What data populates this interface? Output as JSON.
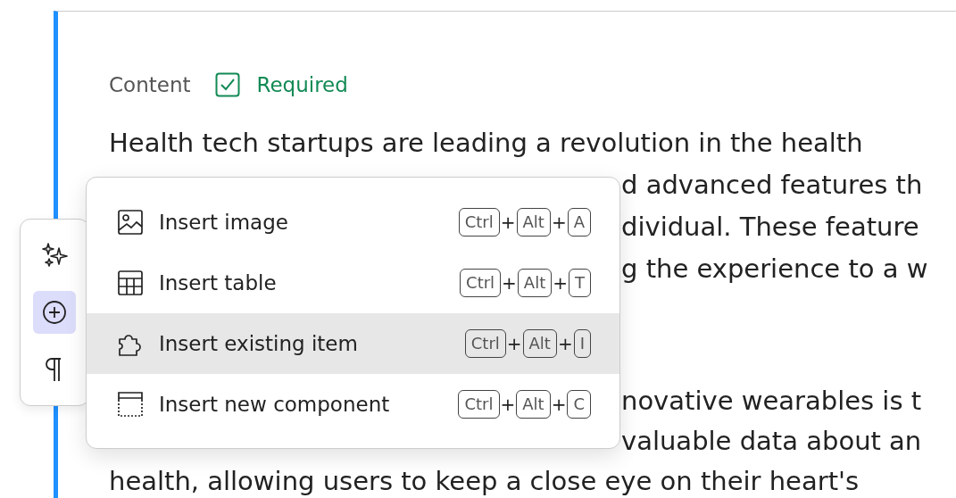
{
  "field": {
    "label": "Content",
    "required": {
      "checked": true,
      "label": "Required"
    }
  },
  "paragraphs": [
    {
      "lines": [
        {
          "kind": "full",
          "text": "Health tech startups are leading a revolution in the health"
        },
        {
          "kind": "fragment",
          "text": "d advanced features th"
        },
        {
          "kind": "fragment",
          "text": "dividual. These feature"
        },
        {
          "kind": "fragment",
          "text": "g the experience to a w"
        }
      ]
    },
    {
      "lines": [
        {
          "kind": "fragment",
          "text": "novative wearables is t"
        },
        {
          "kind": "fragment",
          "text": "valuable data about an"
        },
        {
          "kind": "full",
          "text": "health, allowing users to keep a close eye on their heart's"
        }
      ]
    }
  ],
  "toolbar": [
    {
      "kind": "sparkles",
      "selected": false
    },
    {
      "kind": "insert",
      "selected": true
    },
    {
      "kind": "paragraph",
      "selected": false
    }
  ],
  "menu": [
    {
      "kind": "image",
      "label": "Insert image",
      "selected": false,
      "shortcut": [
        {
          "kind": "key",
          "text": "Ctrl"
        },
        {
          "kind": "plus",
          "text": "+"
        },
        {
          "kind": "key",
          "text": "Alt"
        },
        {
          "kind": "plus",
          "text": "+"
        },
        {
          "kind": "key",
          "text": "A"
        }
      ]
    },
    {
      "kind": "table",
      "label": "Insert table",
      "selected": false,
      "shortcut": [
        {
          "kind": "key",
          "text": "Ctrl"
        },
        {
          "kind": "plus",
          "text": "+"
        },
        {
          "kind": "key",
          "text": "Alt"
        },
        {
          "kind": "plus",
          "text": "+"
        },
        {
          "kind": "key",
          "text": "T"
        }
      ]
    },
    {
      "kind": "puzzle",
      "label": "Insert existing item",
      "selected": true,
      "shortcut": [
        {
          "kind": "key",
          "text": "Ctrl"
        },
        {
          "kind": "plus",
          "text": "+"
        },
        {
          "kind": "key",
          "text": "Alt"
        },
        {
          "kind": "plus",
          "text": "+"
        },
        {
          "kind": "key",
          "text": "I"
        }
      ]
    },
    {
      "kind": "component",
      "label": "Insert new component",
      "selected": false,
      "shortcut": [
        {
          "kind": "key",
          "text": "Ctrl"
        },
        {
          "kind": "plus",
          "text": "+"
        },
        {
          "kind": "key",
          "text": "Alt"
        },
        {
          "kind": "plus",
          "text": "+"
        },
        {
          "kind": "key",
          "text": "C"
        }
      ]
    }
  ]
}
